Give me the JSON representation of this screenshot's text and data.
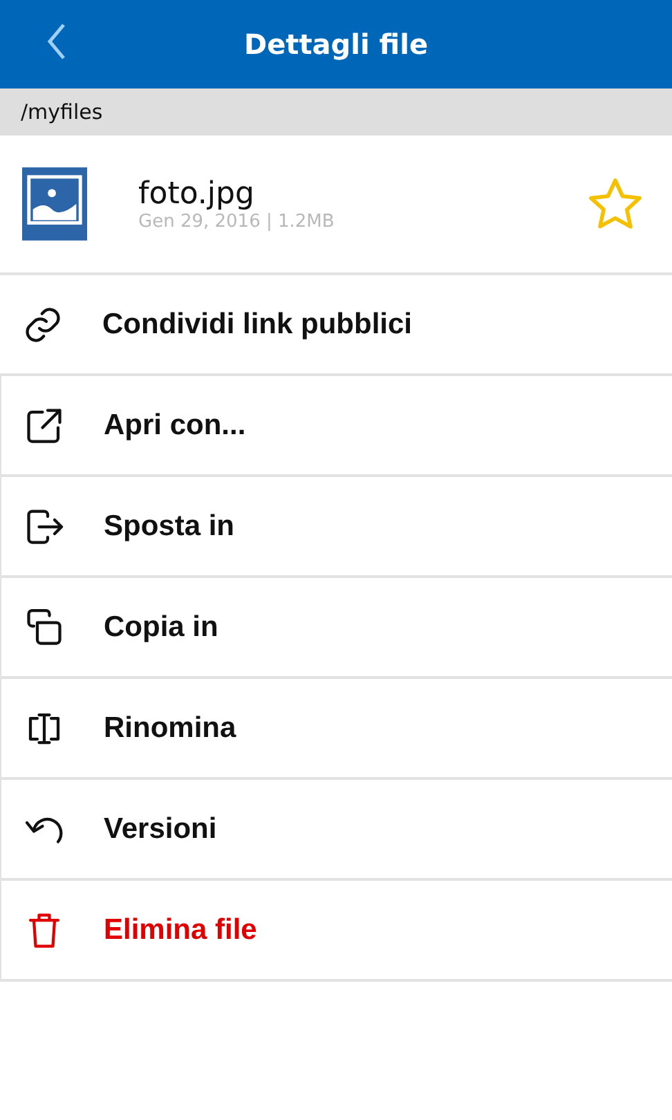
{
  "header": {
    "title": "Dettagli file"
  },
  "path": "/myfiles",
  "file": {
    "name": "foto.jpg",
    "meta": "Gen 29, 2016 | 1.2MB",
    "favorite": false
  },
  "actions": [
    {
      "kind": "link",
      "label": "Condividi link pubblici"
    },
    {
      "kind": "open",
      "label": "Apri con..."
    },
    {
      "kind": "move",
      "label": "Sposta in"
    },
    {
      "kind": "copy",
      "label": "Copia in"
    },
    {
      "kind": "rename",
      "label": "Rinomina"
    },
    {
      "kind": "versions",
      "label": "Versioni"
    },
    {
      "kind": "delete",
      "label": "Elimina file"
    }
  ]
}
